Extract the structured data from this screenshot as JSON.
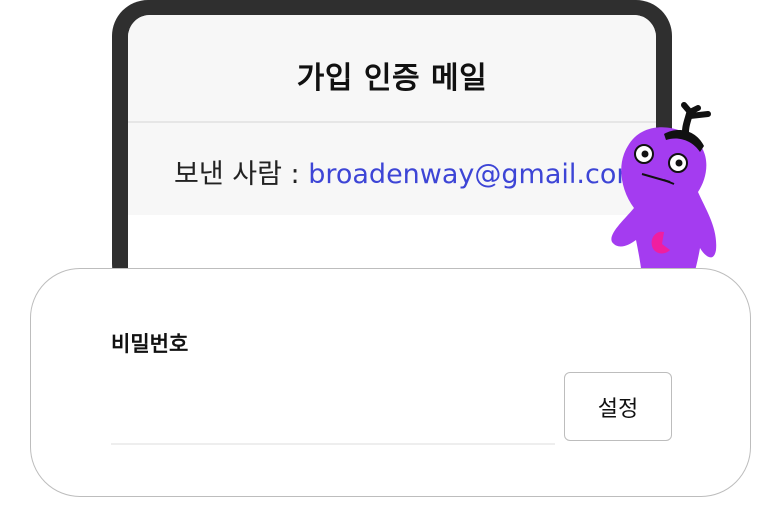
{
  "email": {
    "title": "가입 인증 메일",
    "sender_label": "보낸 사람 : ",
    "sender_email": "broadenway@gmail.com"
  },
  "form": {
    "password_label": "비밀번호",
    "password_value": "",
    "set_button_label": "설정"
  },
  "colors": {
    "accent_link": "#3d45d6",
    "mascot": "#a43cf0",
    "mascot_accent": "#f01ea0"
  }
}
